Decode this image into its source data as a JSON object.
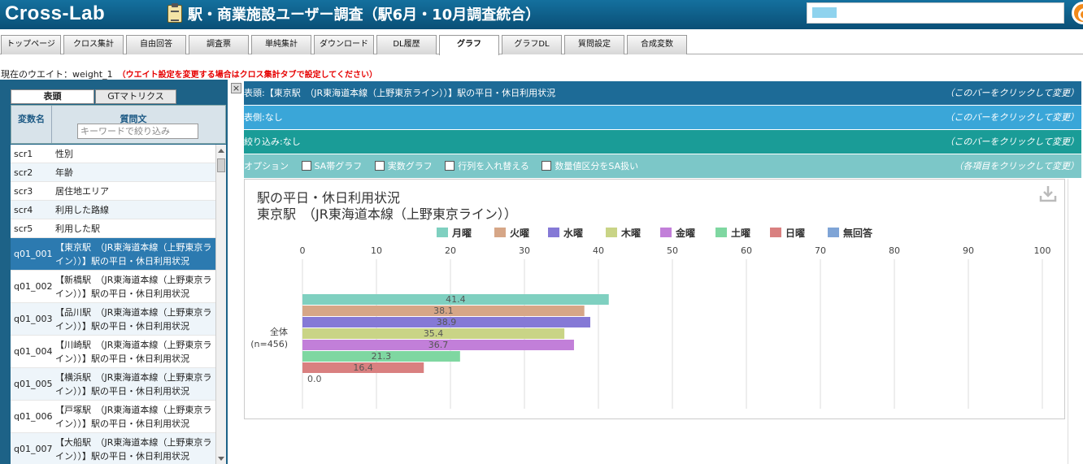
{
  "header": {
    "logo": "Cross-Lab",
    "title": "駅・商業施設ユーザー調査（駅6月・10月調査統合）"
  },
  "tabs": [
    {
      "label": "トップページ"
    },
    {
      "label": "クロス集計"
    },
    {
      "label": "自由回答"
    },
    {
      "label": "調査票"
    },
    {
      "label": "単純集計"
    },
    {
      "label": "ダウンロード"
    },
    {
      "label": "DL履歴"
    },
    {
      "label": "グラフ"
    },
    {
      "label": "グラフDL"
    },
    {
      "label": "質問設定"
    },
    {
      "label": "合成変数"
    }
  ],
  "weight": {
    "label": "現在のウエイト：weight_1",
    "note": "（ウエイト設定を変更する場合はクロス集計タブで設定してください）"
  },
  "left_panel": {
    "tab_head": "表頭",
    "tab_gt": "GTマトリクス",
    "col_var": "変数名",
    "col_question": "質問文",
    "search_placeholder": "キーワードで絞り込み",
    "rows": [
      {
        "id": "scr1",
        "text": "性別"
      },
      {
        "id": "scr2",
        "text": "年齢"
      },
      {
        "id": "scr3",
        "text": "居住地エリア"
      },
      {
        "id": "scr4",
        "text": "利用した路線"
      },
      {
        "id": "scr5",
        "text": "利用した駅"
      },
      {
        "id": "q01_001",
        "text": "【東京駅　（JR東海道本線（上野東京ライン））】駅の平日・休日利用状況"
      },
      {
        "id": "q01_002",
        "text": "【新橋駅　（JR東海道本線（上野東京ライン））】駅の平日・休日利用状況"
      },
      {
        "id": "q01_003",
        "text": "【品川駅　（JR東海道本線（上野東京ライン））】駅の平日・休日利用状況"
      },
      {
        "id": "q01_004",
        "text": "【川崎駅　（JR東海道本線（上野東京ライン））】駅の平日・休日利用状況"
      },
      {
        "id": "q01_005",
        "text": "【横浜駅　（JR東海道本線（上野東京ライン））】駅の平日・休日利用状況"
      },
      {
        "id": "q01_006",
        "text": "【戸塚駅　（JR東海道本線（上野東京ライン））】駅の平日・休日利用状況"
      },
      {
        "id": "q01_007",
        "text": "【大船駅　（JR東海道本線（上野東京ライン））】駅の平日・休日利用状況"
      }
    ]
  },
  "bars": {
    "head": "表頭:【東京駅　（JR東海道本線（上野東京ライン））】駅の平日・休日利用状況",
    "side": "表側:なし",
    "filter": "絞り込み:なし",
    "options_label": "オプション",
    "options": [
      "SA帯グラフ",
      "実数グラフ",
      "行列を入れ替える",
      "数量値区分をSA扱い"
    ],
    "click_hint": "（このバーをクリックして変更）",
    "options_hint": "（各項目をクリックして変更）"
  },
  "chart_data": {
    "type": "bar",
    "orientation": "horizontal",
    "title": "駅の平日・休日利用状況",
    "subtitle": "東京駅　（JR東海道本線（上野東京ライン））",
    "categories": [
      "全体\n(n=456)"
    ],
    "category_lines": [
      "全体",
      "(n=456)"
    ],
    "xlim": [
      0,
      100
    ],
    "xticks": [
      0,
      10,
      20,
      30,
      40,
      50,
      60,
      70,
      80,
      90,
      100
    ],
    "grid": true,
    "legend_position": "top",
    "series": [
      {
        "name": "月曜",
        "values": [
          41.4
        ],
        "color": "#7fd0c0"
      },
      {
        "name": "火曜",
        "values": [
          38.1
        ],
        "color": "#d6a687"
      },
      {
        "name": "水曜",
        "values": [
          38.9
        ],
        "color": "#8579d6"
      },
      {
        "name": "木曜",
        "values": [
          35.4
        ],
        "color": "#c9d486"
      },
      {
        "name": "金曜",
        "values": [
          36.7
        ],
        "color": "#c27fd9"
      },
      {
        "name": "土曜",
        "values": [
          21.3
        ],
        "color": "#7fd7a1"
      },
      {
        "name": "日曜",
        "values": [
          16.4
        ],
        "color": "#d98080"
      },
      {
        "name": "無回答",
        "values": [
          0.0
        ],
        "color": "#7fa4d6"
      }
    ]
  }
}
